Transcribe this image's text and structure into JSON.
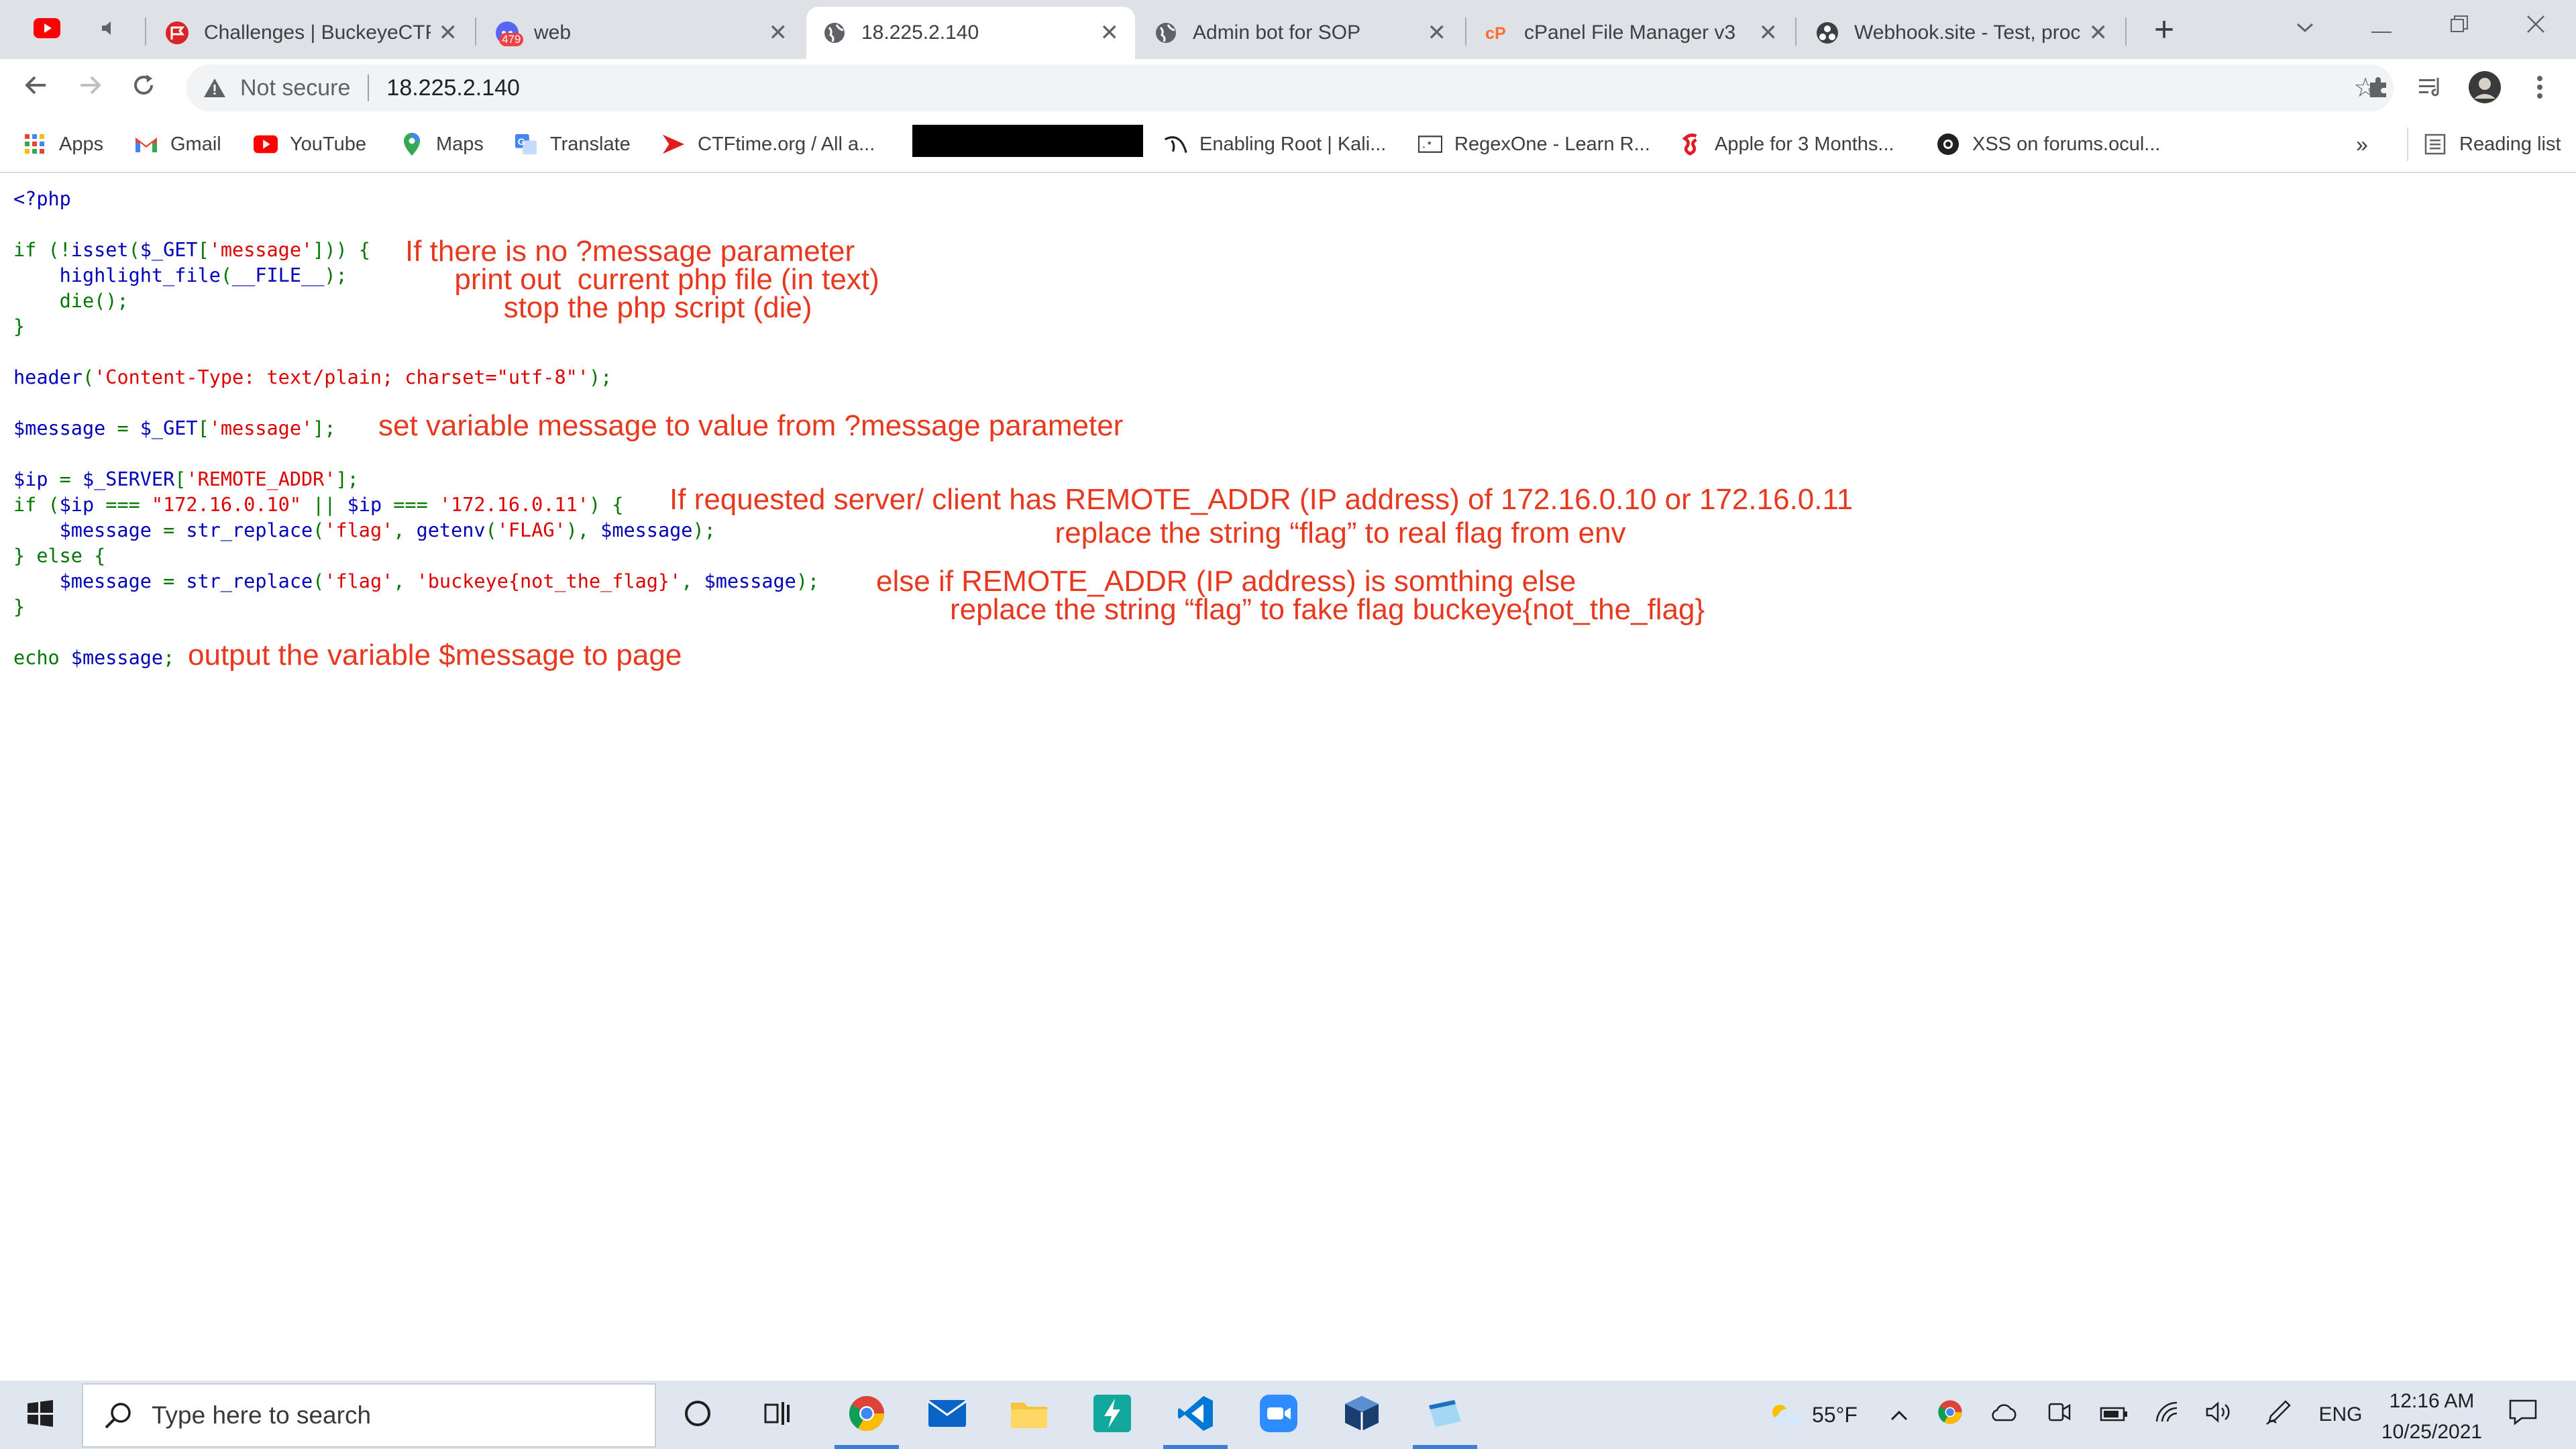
{
  "browser": {
    "tabs": [
      {
        "title": "Challenges | BuckeyeCTF",
        "favicon": "ctfd-flag-icon",
        "active": false
      },
      {
        "title": "web",
        "favicon": "discord-icon",
        "badge": "479",
        "active": false
      },
      {
        "title": "18.225.2.140",
        "favicon": "globe-icon",
        "active": true
      },
      {
        "title": "Admin bot for SOP",
        "favicon": "globe-icon",
        "active": false
      },
      {
        "title": "cPanel File Manager v3",
        "favicon": "cpanel-icon",
        "active": false
      },
      {
        "title": "Webhook.site - Test, proc",
        "favicon": "webhook-icon",
        "active": false
      }
    ],
    "address": {
      "security_label": "Not secure",
      "url": "18.225.2.140"
    },
    "bookmarks": [
      {
        "label": "Apps",
        "icon": "apps-grid-icon"
      },
      {
        "label": "Gmail",
        "icon": "gmail-icon"
      },
      {
        "label": "YouTube",
        "icon": "youtube-icon"
      },
      {
        "label": "Maps",
        "icon": "maps-icon"
      },
      {
        "label": "Translate",
        "icon": "translate-icon"
      },
      {
        "label": "CTFtime.org / All a...",
        "icon": "ctftime-icon"
      },
      {
        "label": "Enabling Root | Kali...",
        "icon": "kali-icon"
      },
      {
        "label": "RegexOne - Learn R...",
        "icon": "regexone-icon"
      },
      {
        "label": "Apple for 3 Months...",
        "icon": "lastpass-icon"
      },
      {
        "label": "XSS on forums.ocul...",
        "icon": "github-icon"
      }
    ],
    "reading_list": "Reading list",
    "overflow": "»"
  },
  "page": {
    "annotations": {
      "if_block": "If there is no ?message parameter\n      print out  current php file (in text)\n            stop the php script (die)",
      "message": "set variable message to value from ?message parameter",
      "ip_check": "If requested server/ client has REMOTE_ADDR (IP address) of 172.16.0.10 or 172.16.0.11\n                                               replace the string “flag” to real flag from env",
      "else_block": "else if REMOTE_ADDR (IP address) is somthing else\n         replace the string “flag” to fake flag buckeye{not_the_flag}",
      "echo": "output the variable $message to page"
    }
  },
  "taskbar": {
    "search_placeholder": "Type here to search",
    "weather": "55°F",
    "language": "ENG",
    "time": "12:16 AM",
    "date": "10/25/2021"
  },
  "colors": {
    "annotation": "#e8391f",
    "php_keyword": "#007700",
    "php_default": "#0000bb",
    "php_string": "#dd0000"
  }
}
